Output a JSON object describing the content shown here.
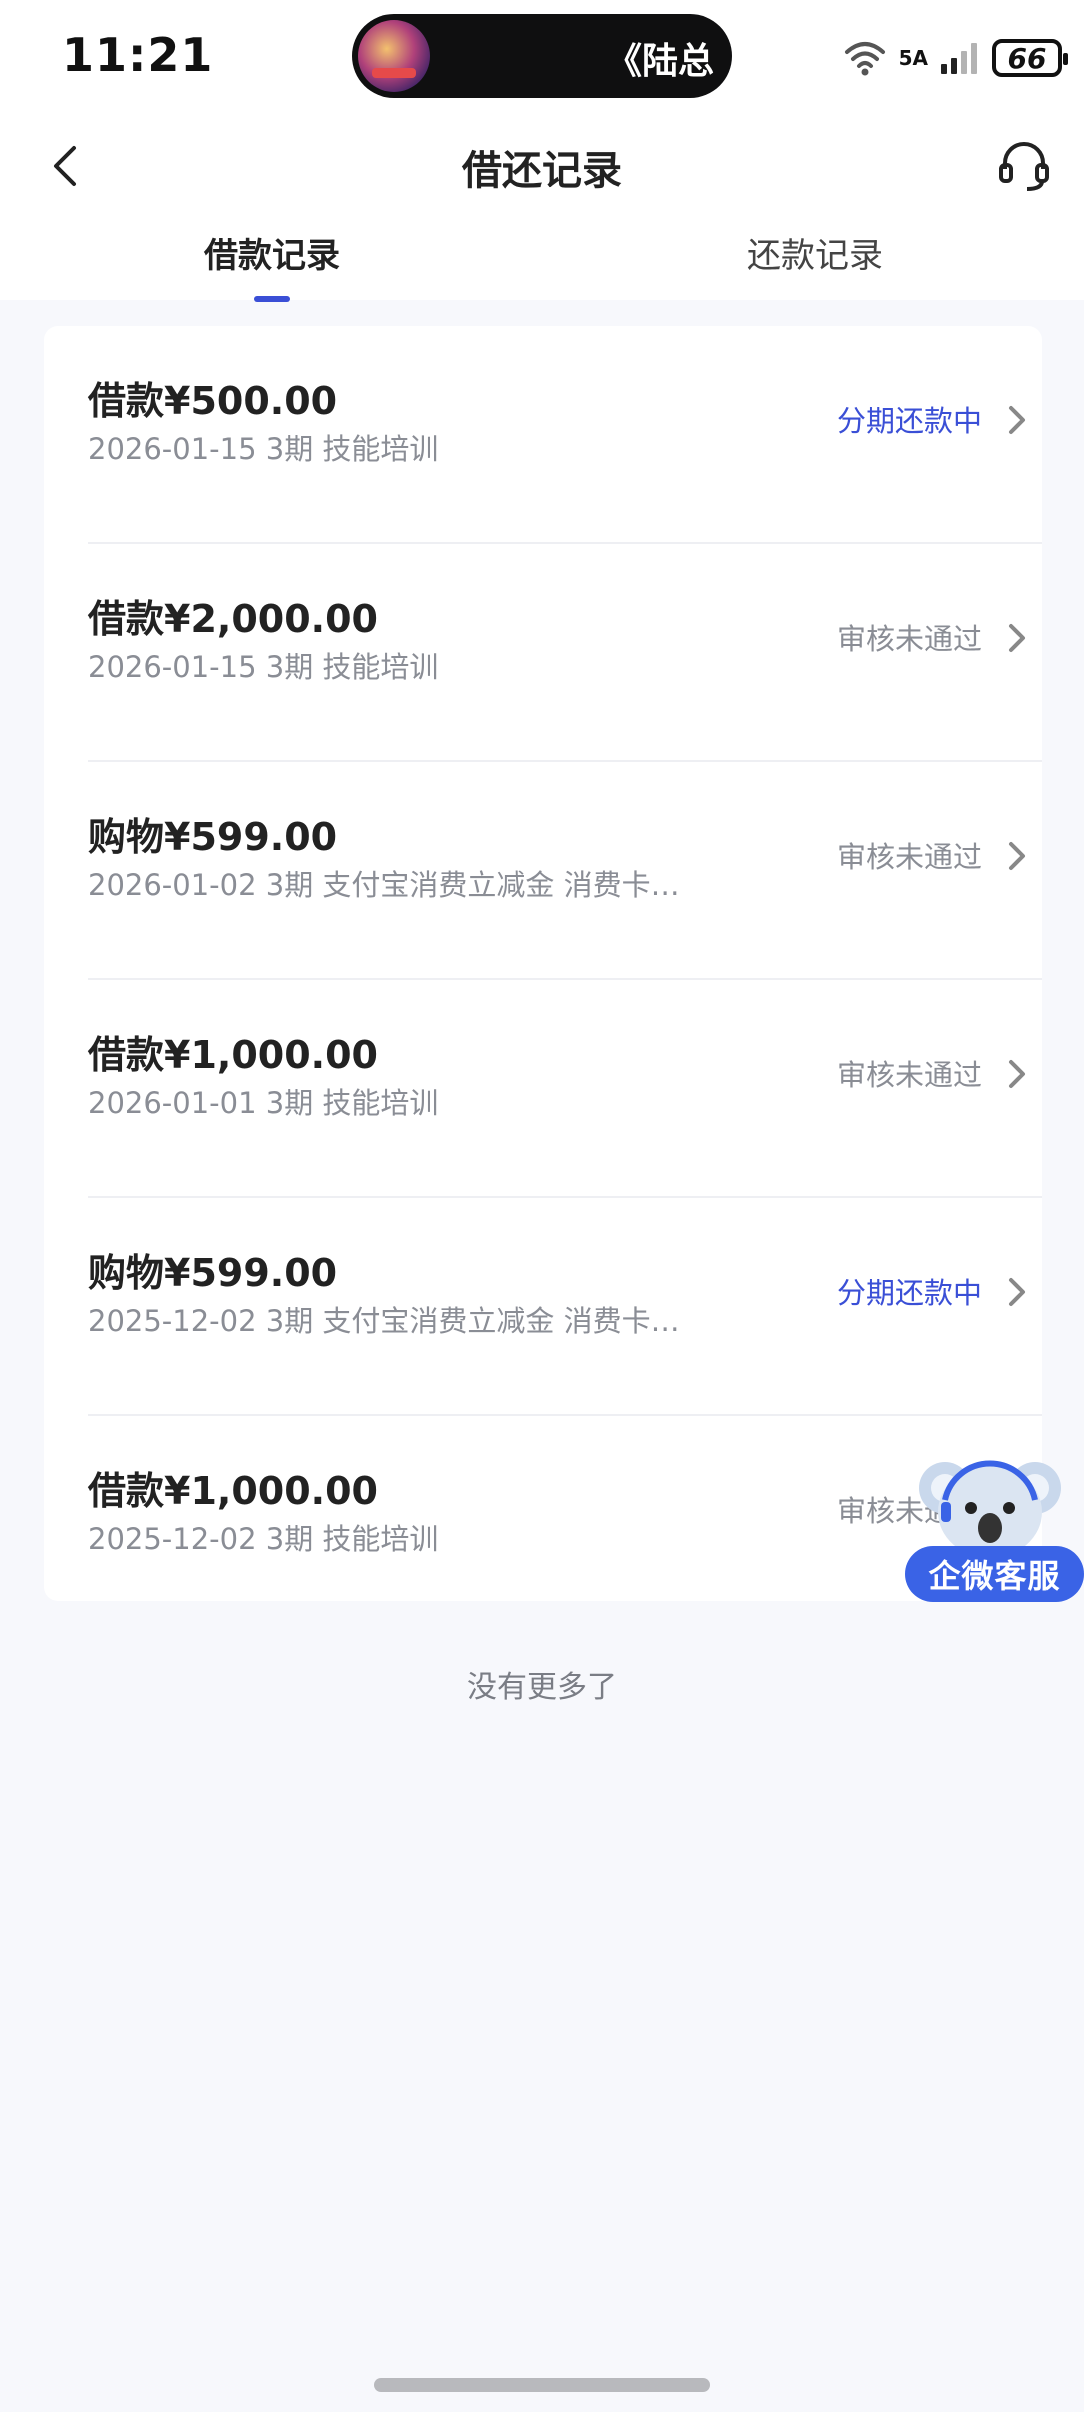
{
  "status_bar": {
    "time": "11:21",
    "now_playing": "《陆总",
    "network": "5A",
    "battery": "66"
  },
  "header": {
    "title": "借还记录"
  },
  "tabs": [
    {
      "label": "借款记录",
      "active": true
    },
    {
      "label": "还款记录",
      "active": false
    }
  ],
  "records": [
    {
      "amount": "借款¥500.00",
      "meta": "2026-01-15 3期  技能培训",
      "status": "分期还款中",
      "status_color": "#3a4fd6"
    },
    {
      "amount": "借款¥2,000.00",
      "meta": "2026-01-15 3期  技能培训",
      "status": "审核未通过",
      "status_color": "#8a8d95"
    },
    {
      "amount": "购物¥599.00",
      "meta": "2026-01-02 3期  支付宝消费立减金 消费卡…",
      "status": "审核未通过",
      "status_color": "#8a8d95"
    },
    {
      "amount": "借款¥1,000.00",
      "meta": "2026-01-01 3期  技能培训",
      "status": "审核未通过",
      "status_color": "#8a8d95"
    },
    {
      "amount": "购物¥599.00",
      "meta": "2025-12-02 3期  支付宝消费立减金 消费卡…",
      "status": "分期还款中",
      "status_color": "#3a4fd6"
    },
    {
      "amount": "借款¥1,000.00",
      "meta": "2025-12-02 3期  技能培训",
      "status": "审核未通过",
      "status_color": "#8a8d95"
    }
  ],
  "footer": {
    "no_more": "没有更多了"
  },
  "floating_service": {
    "label": "企微客服"
  },
  "icons": {
    "back": "chevron-left-icon",
    "service": "headset-icon",
    "row_arrow": "chevron-right-icon",
    "mascot": "koala-mascot-icon"
  }
}
